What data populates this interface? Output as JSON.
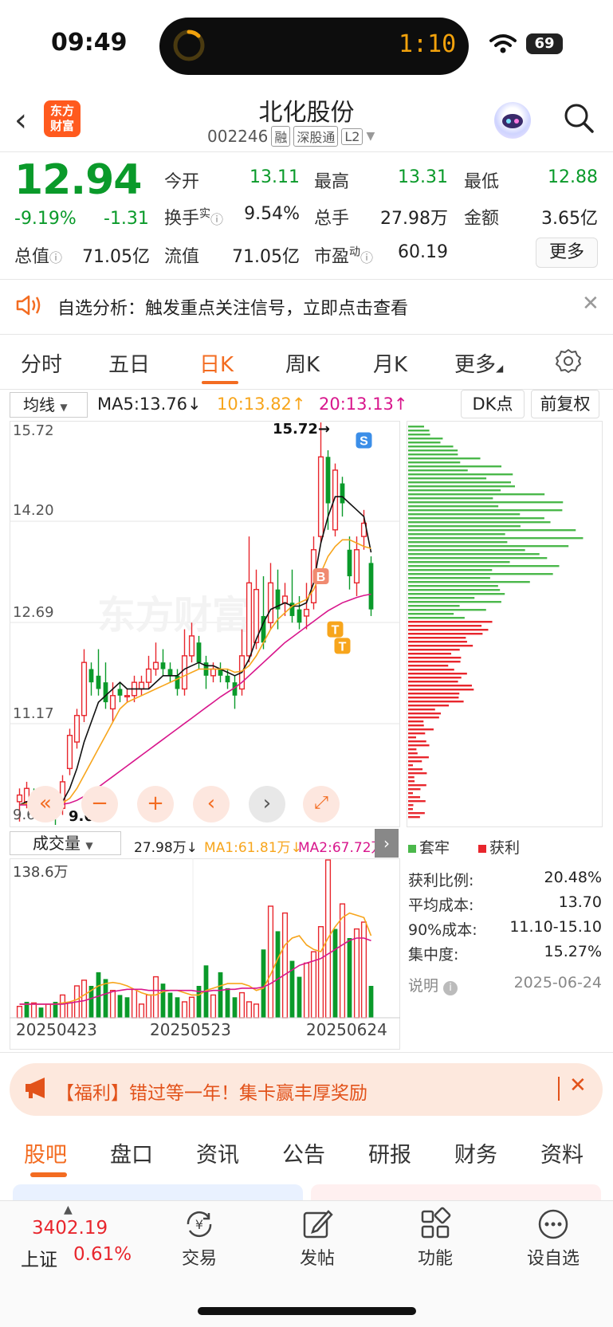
{
  "status_bar": {
    "time": "09:49",
    "timer": "1:10",
    "battery": "69"
  },
  "header": {
    "logo_line1": "东方",
    "logo_line2": "财富",
    "title": "北化股份",
    "code": "002246",
    "tags": [
      "融",
      "深股通",
      "L2"
    ]
  },
  "quote": {
    "price": "12.94",
    "change_pct": "-9.19%",
    "change_abs": "-1.31",
    "open_label": "今开",
    "open": "13.11",
    "high_label": "最高",
    "high": "13.31",
    "low_label": "最低",
    "low": "12.88",
    "turnover_label": "换手",
    "turnover_sup": "实",
    "turnover": "9.54%",
    "volume_label": "总手",
    "volume": "27.98万",
    "amount_label": "金额",
    "amount": "3.65亿",
    "mktcap_label": "总值",
    "mktcap": "71.05亿",
    "float_label": "流值",
    "float_cap": "71.05亿",
    "pe_label": "市盈",
    "pe_sup": "动",
    "pe": "60.19",
    "more_label": "更多"
  },
  "notice": {
    "text": "自选分析：触发重点关注信号，立即点击查看"
  },
  "chart_tabs": [
    "分时",
    "五日",
    "日K",
    "周K",
    "月K",
    "更多"
  ],
  "ma_bar": {
    "selector": "均线",
    "ma5": "MA5:13.76↓",
    "ma10": "10:13.82↑",
    "ma20": "20:13.13↑",
    "dk": "DK点",
    "adjust": "前复权"
  },
  "kline_labels": {
    "y_ticks": [
      "15.72",
      "14.20",
      "12.69",
      "11.17",
      "9.65"
    ],
    "high_mark": "15.72→",
    "low_mark": "9.65",
    "signals": [
      "S",
      "B",
      "T",
      "T"
    ]
  },
  "volume_bar": {
    "selector": "成交量",
    "value": "27.98万↓",
    "ma1": "MA1:61.81万↓",
    "ma2": "MA2:67.72万",
    "y_max": "138.6万",
    "dates": [
      "20250423",
      "20250523",
      "20250624"
    ]
  },
  "chip_panel": {
    "legend_trapped": "套牢",
    "legend_profit": "获利",
    "profit_ratio_label": "获利比例:",
    "profit_ratio": "20.48%",
    "avg_cost_label": "平均成本:",
    "avg_cost": "13.70",
    "cost90_label": "90%成本:",
    "cost90": "11.10-15.10",
    "concentration_label": "集中度:",
    "concentration": "15.27%",
    "note_label": "说明",
    "date": "2025-06-24"
  },
  "promo": {
    "text": "【福利】错过等一年！集卡赢丰厚奖励"
  },
  "bottom_tabs": [
    "股吧",
    "盘口",
    "资讯",
    "公告",
    "研报",
    "财务",
    "资料"
  ],
  "bottom_nav": {
    "index_value": "3402.19",
    "index_name": "上证",
    "index_pct": "0.61%",
    "items": [
      "交易",
      "发帖",
      "功能",
      "设自选"
    ]
  },
  "colors": {
    "down": "#0a9a2a",
    "up": "#e8262d",
    "accent": "#f36c21",
    "ma10": "#f7a51c",
    "ma20": "#d8168c"
  },
  "chart_data": [
    {
      "type": "candlestick",
      "title": "",
      "ylim": [
        9.65,
        15.72
      ],
      "y_ticks": [
        15.72,
        14.2,
        12.69,
        11.17,
        9.65
      ],
      "candles": [
        [
          10.0,
          10.1,
          9.7,
          10.2
        ],
        [
          10.0,
          10.2,
          9.9,
          10.3
        ],
        [
          10.1,
          9.9,
          9.8,
          10.2
        ],
        [
          9.9,
          10.1,
          9.7,
          10.2
        ],
        [
          10.0,
          9.9,
          9.7,
          10.1
        ],
        [
          10.0,
          9.85,
          9.65,
          10.05
        ],
        [
          9.9,
          10.3,
          9.8,
          10.4
        ],
        [
          10.5,
          11.0,
          10.4,
          11.1
        ],
        [
          10.9,
          11.3,
          10.8,
          11.4
        ],
        [
          11.3,
          12.1,
          11.2,
          12.3
        ],
        [
          12.0,
          11.8,
          11.6,
          12.1
        ],
        [
          11.9,
          11.7,
          11.6,
          12.3
        ],
        [
          11.8,
          11.5,
          11.4,
          12.1
        ],
        [
          11.4,
          11.6,
          11.2,
          11.8
        ],
        [
          11.7,
          11.6,
          11.5,
          11.8
        ],
        [
          11.6,
          11.6,
          11.5,
          11.7
        ],
        [
          11.6,
          11.8,
          11.5,
          11.9
        ],
        [
          11.7,
          11.8,
          11.6,
          11.9
        ],
        [
          11.8,
          12.0,
          11.7,
          12.2
        ],
        [
          12.0,
          12.1,
          11.9,
          12.4
        ],
        [
          12.1,
          12.0,
          11.9,
          12.3
        ],
        [
          12.0,
          11.9,
          11.8,
          12.1
        ],
        [
          11.9,
          11.7,
          11.6,
          12.0
        ],
        [
          11.7,
          12.2,
          11.6,
          12.6
        ],
        [
          12.2,
          12.5,
          12.1,
          12.7
        ],
        [
          12.4,
          12.1,
          12.0,
          12.5
        ],
        [
          12.1,
          11.9,
          11.7,
          12.2
        ],
        [
          11.9,
          12.0,
          11.8,
          12.1
        ],
        [
          12.0,
          11.9,
          11.8,
          12.1
        ],
        [
          11.9,
          11.8,
          11.7,
          12.0
        ],
        [
          11.8,
          11.6,
          11.4,
          11.9
        ],
        [
          11.7,
          12.2,
          11.6,
          12.6
        ],
        [
          12.2,
          13.3,
          12.1,
          14.0
        ],
        [
          12.4,
          13.2,
          12.3,
          13.5
        ],
        [
          12.8,
          12.4,
          12.3,
          13.4
        ],
        [
          12.7,
          13.3,
          12.6,
          13.6
        ],
        [
          13.2,
          12.9,
          12.6,
          13.5
        ],
        [
          13.0,
          13.1,
          12.8,
          13.3
        ],
        [
          13.0,
          12.8,
          12.7,
          13.5
        ],
        [
          12.9,
          12.7,
          12.6,
          13.1
        ],
        [
          12.8,
          12.9,
          12.6,
          13.3
        ],
        [
          13.0,
          13.8,
          12.9,
          14.0
        ],
        [
          14.0,
          15.2,
          13.9,
          15.72
        ],
        [
          15.2,
          14.5,
          14.1,
          15.3
        ],
        [
          14.1,
          15.0,
          14.0,
          15.1
        ],
        [
          14.8,
          14.5,
          14.3,
          14.9
        ],
        [
          13.8,
          13.4,
          13.2,
          14.0
        ],
        [
          13.3,
          13.8,
          13.1,
          14.0
        ],
        [
          14.0,
          14.2,
          13.8,
          14.4
        ],
        [
          13.6,
          12.9,
          12.8,
          13.7
        ]
      ],
      "ma5": [
        9.95,
        10.0,
        10.02,
        10.03,
        9.98,
        9.95,
        10.0,
        10.2,
        10.5,
        10.9,
        11.2,
        11.5,
        11.6,
        11.7,
        11.8,
        11.7,
        11.7,
        11.7,
        11.7,
        11.8,
        11.9,
        11.9,
        11.9,
        12.0,
        12.05,
        12.1,
        12.05,
        12.05,
        12.0,
        11.95,
        11.9,
        11.95,
        12.15,
        12.45,
        12.7,
        12.9,
        12.95,
        13.0,
        12.95,
        12.95,
        13.0,
        13.3,
        13.9,
        14.3,
        14.6,
        14.6,
        14.5,
        14.4,
        14.3,
        13.76
      ],
      "ma10": [
        9.95,
        9.97,
        9.98,
        9.99,
        9.98,
        9.97,
        9.98,
        10.05,
        10.2,
        10.4,
        10.6,
        10.8,
        11.0,
        11.2,
        11.4,
        11.5,
        11.55,
        11.6,
        11.65,
        11.7,
        11.75,
        11.8,
        11.85,
        11.9,
        11.95,
        12.0,
        12.0,
        12.0,
        12.0,
        12.0,
        11.95,
        11.97,
        12.05,
        12.2,
        12.4,
        12.6,
        12.75,
        12.85,
        12.95,
        13.0,
        13.05,
        13.2,
        13.45,
        13.7,
        13.85,
        13.95,
        13.95,
        13.9,
        13.85,
        13.82
      ],
      "ma20": [
        9.95,
        9.95,
        9.95,
        9.95,
        9.95,
        9.95,
        9.96,
        9.98,
        10.02,
        10.08,
        10.15,
        10.22,
        10.3,
        10.38,
        10.46,
        10.54,
        10.62,
        10.7,
        10.78,
        10.86,
        10.94,
        11.02,
        11.1,
        11.18,
        11.26,
        11.34,
        11.42,
        11.5,
        11.58,
        11.65,
        11.72,
        11.8,
        11.9,
        12.0,
        12.1,
        12.2,
        12.3,
        12.4,
        12.48,
        12.56,
        12.64,
        12.72,
        12.8,
        12.88,
        12.94,
        13.0,
        13.04,
        13.08,
        13.11,
        13.13
      ]
    },
    {
      "type": "bar",
      "title": "",
      "ylim": [
        0,
        138.6
      ],
      "unit": "万",
      "values": [
        10,
        14,
        13,
        9,
        12,
        14,
        20,
        13,
        28,
        33,
        28,
        40,
        34,
        24,
        20,
        18,
        25,
        12,
        20,
        36,
        30,
        22,
        18,
        14,
        18,
        28,
        46,
        20,
        40,
        26,
        18,
        22,
        14,
        12,
        60,
        98,
        76,
        92,
        50,
        36,
        48,
        58,
        80,
        138.6,
        78,
        100,
        70,
        78,
        84,
        28
      ],
      "colors_up": [
        1,
        0,
        1,
        0,
        1,
        0,
        1,
        1,
        1,
        1,
        0,
        0,
        0,
        1,
        0,
        0,
        1,
        1,
        1,
        1,
        0,
        0,
        0,
        1,
        1,
        0,
        0,
        1,
        0,
        0,
        0,
        1,
        1,
        1,
        0,
        1,
        0,
        1,
        0,
        0,
        1,
        1,
        1,
        1,
        0,
        1,
        0,
        1,
        1,
        0
      ],
      "ma1": [
        12,
        12,
        12,
        12,
        12,
        12,
        13,
        14,
        16,
        20,
        24,
        28,
        30,
        31,
        30,
        28,
        25,
        22,
        20,
        20,
        23,
        24,
        24,
        22,
        20,
        20,
        24,
        26,
        28,
        30,
        30,
        30,
        28,
        24,
        26,
        38,
        52,
        64,
        70,
        72,
        64,
        60,
        58,
        70,
        80,
        88,
        92,
        90,
        88,
        72
      ],
      "ma2": [
        12,
        12,
        12,
        12,
        12,
        12,
        12,
        13,
        14,
        15,
        17,
        19,
        21,
        23,
        24,
        25,
        25,
        25,
        24,
        24,
        24,
        24,
        24,
        24,
        24,
        23,
        23,
        24,
        24,
        25,
        25,
        26,
        26,
        26,
        27,
        30,
        34,
        38,
        42,
        46,
        48,
        50,
        52,
        56,
        60,
        64,
        68,
        70,
        70,
        67.72
      ]
    }
  ]
}
